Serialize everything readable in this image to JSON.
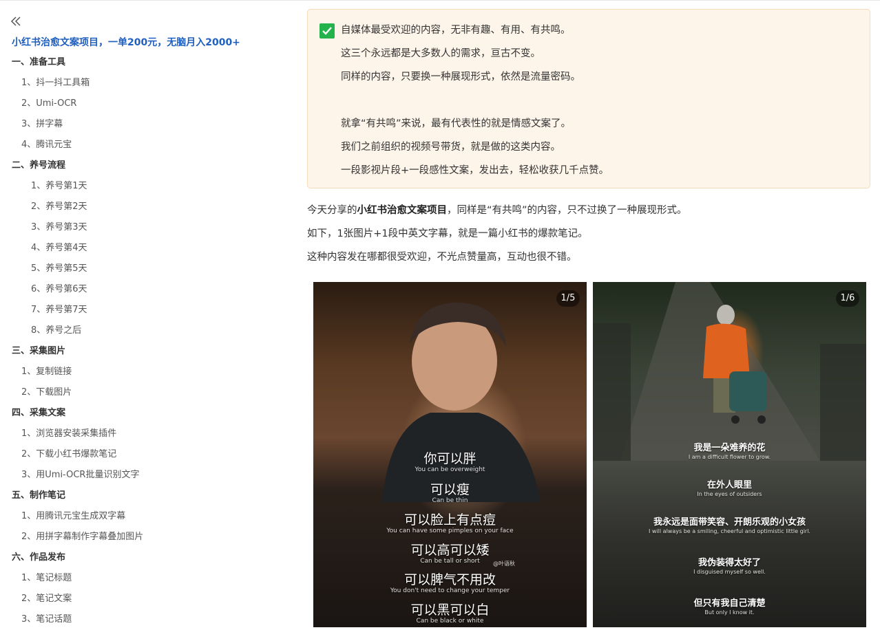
{
  "sidebar": {
    "title": "小红书治愈文案项目，一单200元，无脑月入2000+",
    "items": [
      {
        "label": "一、准备工具",
        "level": 1
      },
      {
        "label": "1、抖一抖工具箱",
        "level": 2
      },
      {
        "label": "2、Umi-OCR",
        "level": 2
      },
      {
        "label": "3、拼字幕",
        "level": 2
      },
      {
        "label": "4、腾讯元宝",
        "level": 2
      },
      {
        "label": "二、养号流程",
        "level": 1
      },
      {
        "label": "1、养号第1天",
        "level": 3
      },
      {
        "label": "2、养号第2天",
        "level": 3
      },
      {
        "label": "3、养号第3天",
        "level": 3
      },
      {
        "label": "4、养号第4天",
        "level": 3
      },
      {
        "label": "5、养号第5天",
        "level": 3
      },
      {
        "label": "6、养号第6天",
        "level": 3
      },
      {
        "label": "7、养号第7天",
        "level": 3
      },
      {
        "label": "8、养号之后",
        "level": 3
      },
      {
        "label": "三、采集图片",
        "level": 1
      },
      {
        "label": "1、复制链接",
        "level": 2
      },
      {
        "label": "2、下载图片",
        "level": 2
      },
      {
        "label": "四、采集文案",
        "level": 1
      },
      {
        "label": "1、浏览器安装采集插件",
        "level": 2
      },
      {
        "label": "2、下载小红书爆款笔记",
        "level": 2
      },
      {
        "label": "3、用Umi-OCR批量识别文字",
        "level": 2
      },
      {
        "label": "五、制作笔记",
        "level": 1
      },
      {
        "label": "1、用腾讯元宝生成双字幕",
        "level": 2
      },
      {
        "label": "2、用拼字幕制作字幕叠加图片",
        "level": 2
      },
      {
        "label": "六、作品发布",
        "level": 1
      },
      {
        "label": "1、笔记标题",
        "level": 2
      },
      {
        "label": "2、笔记文案",
        "level": 2
      },
      {
        "label": "3、笔记话题",
        "level": 2
      }
    ]
  },
  "callout": {
    "lines": [
      "自媒体最受欢迎的内容，无非有趣、有用、有共鸣。",
      "这三个永远都是大多数人的需求，亘古不变。",
      "同样的内容，只要换一种展现形式，依然是流量密码。",
      "",
      "就拿“有共鸣”来说，最有代表性的就是情感文案了。",
      "我们之前组织的视频号带货，就是做的这类内容。",
      "一段影视片段+一段感性文案，发出去，轻松收获几千点赞。"
    ]
  },
  "paragraphs": {
    "p1_before": "今天分享的",
    "p1_bold": "小红书治愈文案项目",
    "p1_after": "，同样是“有共鸣”的内容，只不过换了一种展现形式。",
    "p2": "如下，1张图片+1段中英文字幕，就是一篇小红书的爆款笔记。",
    "p3": "这种内容发在哪都很受欢迎，不光点赞量高，互动也很不错。"
  },
  "images": [
    {
      "badge": "1/5",
      "watermark": "@叶语秋",
      "subtitles": [
        {
          "cn": "你可以胖",
          "en": "You can be overweight"
        },
        {
          "cn": "可以瘦",
          "en": "Can be thin"
        },
        {
          "cn": "可以脸上有点痘",
          "en": "You can have some pimples on your face"
        },
        {
          "cn": "可以高可以矮",
          "en": "Can be tall or short"
        },
        {
          "cn": "可以脾气不用改",
          "en": "You don't need to change your temper"
        },
        {
          "cn": "可以黑可以白",
          "en": "Can be black or white"
        }
      ]
    },
    {
      "badge": "1/6",
      "subtitles": [
        {
          "cn": "我是一朵难养的花",
          "en": "I am a difficult flower to grow."
        },
        {
          "cn": "在外人眼里",
          "en": "In the eyes of outsiders"
        },
        {
          "cn": "我永远是面带笑容、开朗乐观的小女孩",
          "en": "I will always be a smiling, cheerful and optimistic little girl."
        },
        {
          "cn": "我伪装得太好了",
          "en": "I disguised myself so well."
        },
        {
          "cn": "但只有我自己清楚",
          "en": "But only I know it."
        }
      ]
    }
  ],
  "colors": {
    "toc_title": "#1f5fbf",
    "callout_bg": "#fef5ea",
    "check": "#23b24b"
  }
}
